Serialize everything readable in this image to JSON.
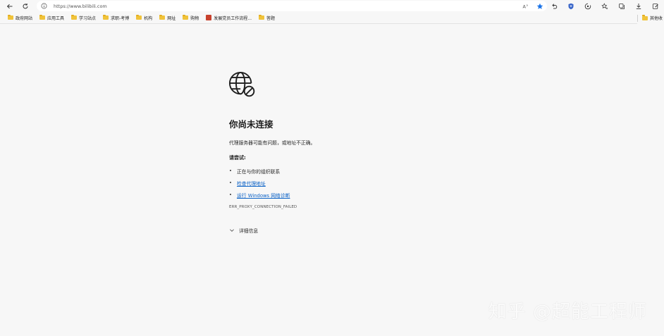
{
  "address_bar": {
    "url": "https://www.bilibili.com"
  },
  "bookmarks": [
    {
      "label": "政府网站",
      "icon": "folder-icon"
    },
    {
      "label": "应用工具",
      "icon": "folder-icon"
    },
    {
      "label": "学习站点",
      "icon": "folder-icon"
    },
    {
      "label": "求职-考博",
      "icon": "folder-icon"
    },
    {
      "label": "机构",
      "icon": "folder-icon"
    },
    {
      "label": "网址",
      "icon": "folder-icon"
    },
    {
      "label": "购物",
      "icon": "folder-icon"
    },
    {
      "label": "发展党员工作流程...",
      "icon": "page-icon"
    },
    {
      "label": "答题",
      "icon": "folder-icon"
    }
  ],
  "other_bookmarks": "其他收",
  "error": {
    "title": "你尚未连接",
    "description": "代理服务器可能有问题，或地址不正确。",
    "try_label": "请尝试:",
    "suggestions": [
      {
        "text": "正在与你的组织联系",
        "link": false
      },
      {
        "text": "检查代理地址",
        "link": true
      },
      {
        "text": "运行 Windows 网络诊断",
        "link": true
      }
    ],
    "code": "ERR_PROXY_CONNECTION_FAILED",
    "details_label": "详细信息"
  },
  "watermark": "知乎 @超能工程师",
  "colors": {
    "link": "#0b62c6",
    "favorite_star": "#1a73e8",
    "folder": "#f0c33b"
  }
}
